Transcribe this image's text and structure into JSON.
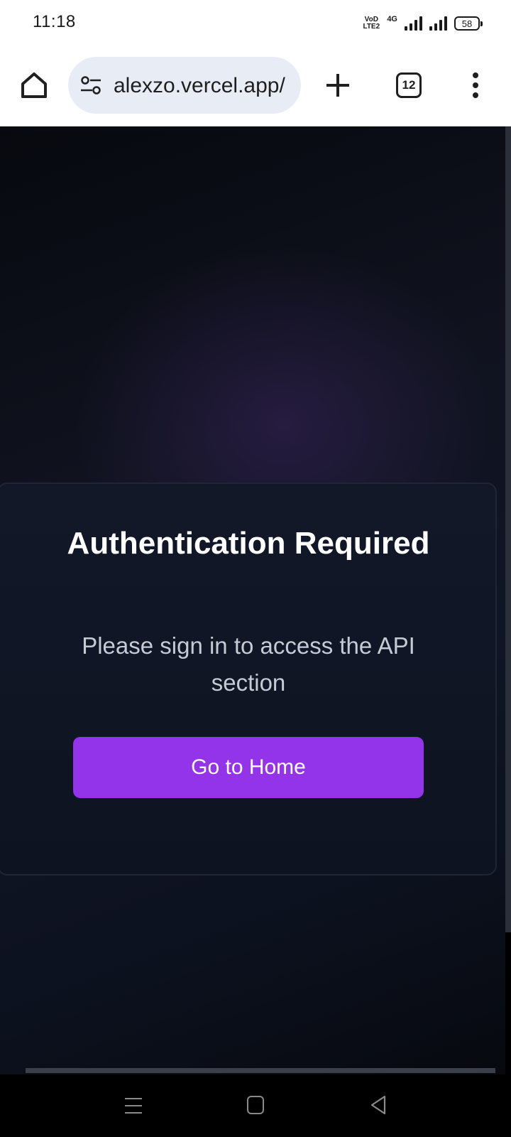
{
  "status_bar": {
    "time": "11:18",
    "volte_label": "VoD LTE2",
    "network_label": "4G",
    "battery": "58"
  },
  "browser": {
    "url": "alexzo.vercel.app/",
    "tab_count": "12",
    "icons": [
      "home-icon",
      "site-settings-icon",
      "new-tab-icon",
      "tab-switcher-icon",
      "more-menu-icon"
    ]
  },
  "auth_card": {
    "title": "Authentication Required",
    "message": "Please sign in to access the API section",
    "button_label": "Go to Home",
    "accent_color": "#9333ea"
  },
  "nav_bar": {
    "icons": [
      "recents-icon",
      "home-icon",
      "back-icon"
    ]
  }
}
